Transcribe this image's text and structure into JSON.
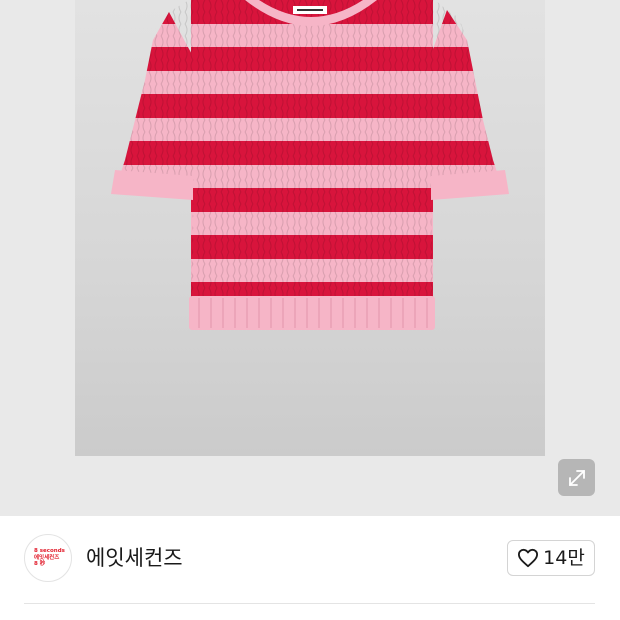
{
  "product_image": {
    "subject": "short-sleeve striped cable-knit sweater",
    "stripe_colors": {
      "pink": "#f6b5c7",
      "red": "#d8143c"
    },
    "background": "#d8d8d8"
  },
  "expand_button": {
    "icon": "expand-arrows-icon"
  },
  "seller": {
    "avatar_logo_lines": [
      "8 seconds",
      "에잇세컨즈",
      "8 秒"
    ],
    "name": "에잇세컨즈"
  },
  "like": {
    "icon": "heart-outline-icon",
    "count": "14만"
  }
}
